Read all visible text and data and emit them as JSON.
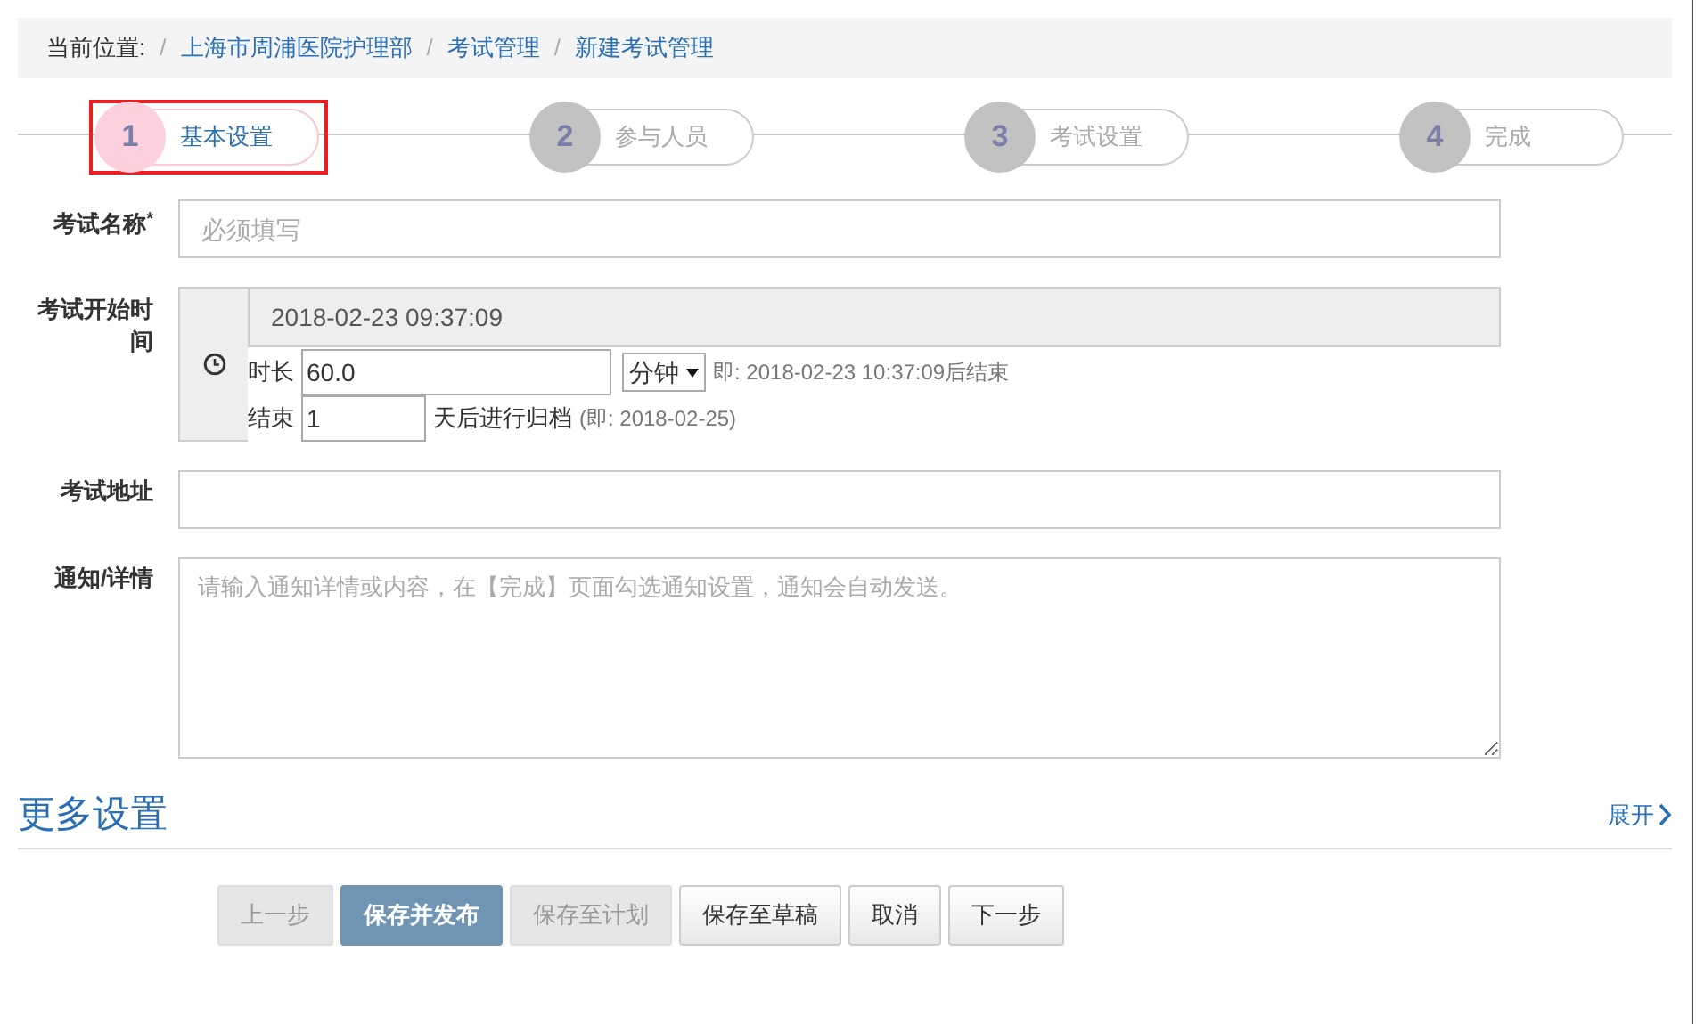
{
  "breadcrumb": {
    "label": "当前位置:",
    "separator": "/",
    "items": [
      "上海市周浦医院护理部",
      "考试管理",
      "新建考试管理"
    ]
  },
  "steps": [
    {
      "number": "1",
      "label": "基本设置",
      "selected": true,
      "highlighted": true
    },
    {
      "number": "2",
      "label": "参与人员",
      "selected": false,
      "highlighted": false
    },
    {
      "number": "3",
      "label": "考试设置",
      "selected": false,
      "highlighted": false
    },
    {
      "number": "4",
      "label": "完成",
      "selected": false,
      "highlighted": false
    }
  ],
  "form": {
    "name": {
      "label": "考试名称",
      "required_mark": "*",
      "placeholder": "必须填写"
    },
    "start_time": {
      "label": "考试开始时间",
      "value": "2018-02-23 09:37:09",
      "duration_label": "时长",
      "duration": "60.0",
      "unit": "分钟",
      "end_note": "即: 2018-02-23 10:37:09后结束",
      "archive_label": "结束",
      "archive_days": "1",
      "archive_suffix": "天后进行归档",
      "archive_note": "(即: 2018-02-25)"
    },
    "address": {
      "label": "考试地址"
    },
    "notes": {
      "label": "通知/详情",
      "placeholder": "请输入通知详情或内容，在【完成】页面勾选通知设置，通知会自动发送。"
    }
  },
  "more_settings": {
    "title": "更多设置",
    "expand_link": "展开"
  },
  "buttons": [
    {
      "label": "上一步",
      "kind": "disabled"
    },
    {
      "label": "保存并发布",
      "kind": "primary"
    },
    {
      "label": "保存至计划",
      "kind": "disabled"
    },
    {
      "label": "保存至草稿",
      "kind": "default"
    },
    {
      "label": "取消",
      "kind": "default"
    },
    {
      "label": "下一步",
      "kind": "default"
    }
  ]
}
